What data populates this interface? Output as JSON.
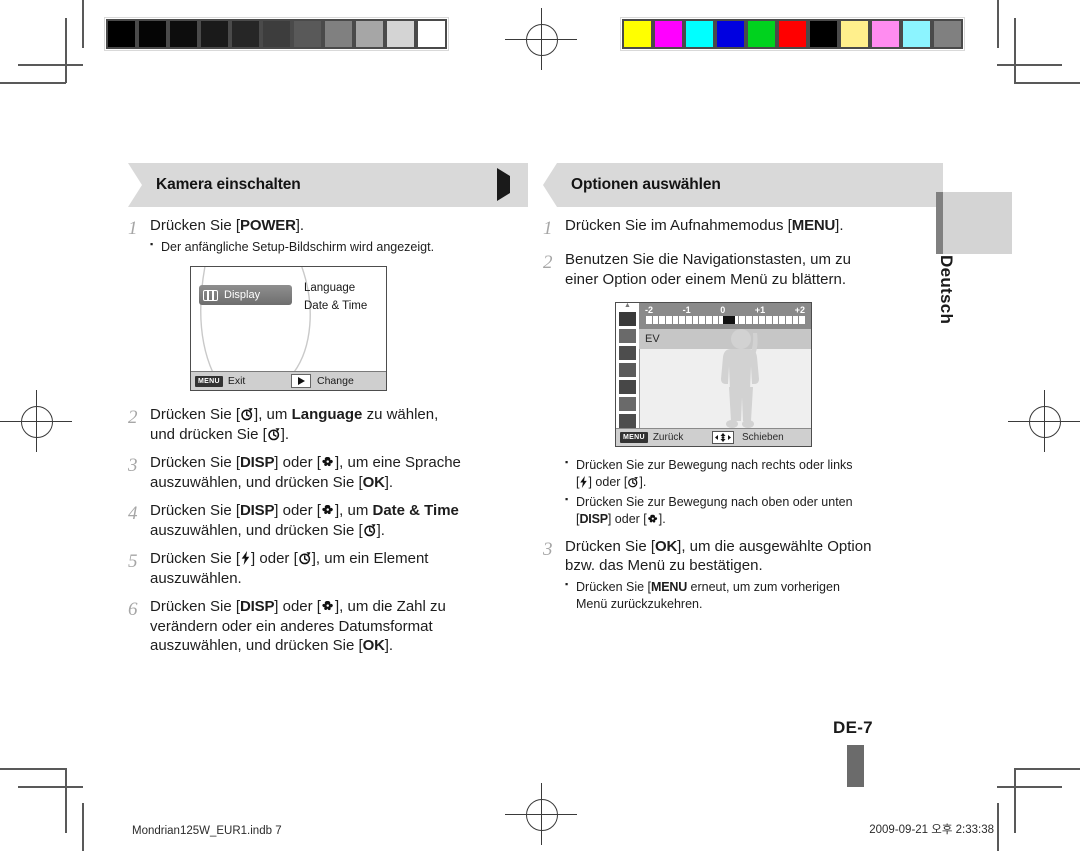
{
  "calibration": {
    "grayscale_patches": [
      "#000000",
      "#050505",
      "#0d0d0d",
      "#1a1a1a",
      "#262626",
      "#3d3d3d",
      "#595959",
      "#808080",
      "#a6a6a6",
      "#d4d4d4",
      "#ffffff"
    ],
    "color_patches": [
      "#ffff00",
      "#ff00ff",
      "#00ffff",
      "#0000e0",
      "#00d21e",
      "#ff0000",
      "#000000",
      "#ffef8c",
      "#ff8cf0",
      "#8cf4ff",
      "#808080"
    ]
  },
  "left_column": {
    "banner": {
      "title": "Kamera einschalten",
      "marker": "triangle-right"
    },
    "steps": [
      {
        "num": "1",
        "text_before": "Drücken Sie [",
        "key": "POWER",
        "text_after": "].",
        "subs": [
          "Der anfängliche Setup-Bildschirm wird angezeigt."
        ]
      },
      {
        "num": "2",
        "line1_a": "Drücken Sie [",
        "line1_icon": "timer-icon",
        "line1_b": "], um ",
        "line1_bold": "Language",
        "line1_c": " zu wählen,",
        "line2_a": "und drücken Sie [",
        "line2_icon": "timer-icon",
        "line2_b": "]."
      },
      {
        "num": "3",
        "line1_a": "Drücken Sie [",
        "line1_key": "DISP",
        "line1_b": "] oder [",
        "line1_icon": "macro-icon",
        "line1_c": "], um eine Sprache",
        "line2_a": "auszuwählen, und drücken Sie [",
        "line2_key": "OK",
        "line2_b": "]."
      },
      {
        "num": "4",
        "line1_a": "Drücken Sie [",
        "line1_key": "DISP",
        "line1_b": "] oder [",
        "line1_icon": "macro-icon",
        "line1_c": "], um ",
        "line1_bold": "Date & Time",
        "line2_a": "auszuwählen, und drücken Sie [",
        "line2_icon": "timer-icon",
        "line2_b": "]."
      },
      {
        "num": "5",
        "line1_a": "Drücken Sie [",
        "line1_icon": "flash-icon",
        "line1_b": "] oder [",
        "line1_icon2": "timer-icon",
        "line1_c": "], um ein Element",
        "line2_a": "auszuwählen."
      },
      {
        "num": "6",
        "line1_a": "Drücken Sie [",
        "line1_key": "DISP",
        "line1_b": "] oder [",
        "line1_icon": "macro-icon",
        "line1_c": "], um die Zahl zu",
        "line2_a": "verändern oder ein anderes Datumsformat",
        "line3_a": "auszuwählen, und drücken Sie [",
        "line3_key": "OK",
        "line3_b": "]."
      }
    ],
    "lcd_setup": {
      "tab_label": "Display",
      "menu_items": [
        "Language",
        "Date & Time"
      ],
      "bottom_left_key": "MENU",
      "bottom_left_label": "Exit",
      "bottom_right_icon": "triangle-right",
      "bottom_right_label": "Change"
    }
  },
  "right_column": {
    "banner": {
      "title": "Optionen auswählen",
      "marker": "square"
    },
    "steps": [
      {
        "num": "1",
        "text_before": "Drücken Sie im Aufnahmemodus [",
        "key": "MENU",
        "text_after": "]."
      },
      {
        "num": "2",
        "line1_a": "Benutzen Sie die Navigationstasten, um zu",
        "line2_a": "einer Option oder einem Menü zu blättern."
      },
      {
        "num": "3",
        "line1_a": "Drücken Sie [",
        "line1_key": "OK",
        "line1_b": "], um die ausgewählte Option",
        "line2_a": "bzw. das Menü zu bestätigen.",
        "sub_a": "Drücken Sie [",
        "sub_key": "MENU",
        "sub_b": " erneut, um zum vorherigen",
        "sub_c": "Menü zurückzukehren."
      }
    ],
    "bullets": [
      {
        "line1": "Drücken Sie zur Bewegung nach rechts oder links",
        "line2_a": "[",
        "line2_icon": "flash-icon",
        "line2_b": "] oder [",
        "line2_icon2": "timer-icon",
        "line2_c": "]."
      },
      {
        "line1": "Drücken Sie zur Bewegung nach oben oder unten",
        "line2_a": "[",
        "line2_key": "DISP",
        "line2_b": "] oder [",
        "line2_icon": "macro-icon",
        "line2_c": "]."
      }
    ],
    "lcd_ev": {
      "scale_labels": [
        "-2",
        "-1",
        "0",
        "+1",
        "+2"
      ],
      "current_value": "0",
      "row_label": "EV",
      "bottom_left_key": "MENU",
      "bottom_left_label": "Zurück",
      "bottom_right_icon": "dpad-icon",
      "bottom_right_label": "Schieben"
    }
  },
  "side_rail": {
    "language": "Deutsch"
  },
  "page": {
    "number": "DE-7"
  },
  "footer": {
    "left": "Mondrian125W_EUR1.indb   7",
    "right": "2009-09-21   오후 2:33:38"
  }
}
